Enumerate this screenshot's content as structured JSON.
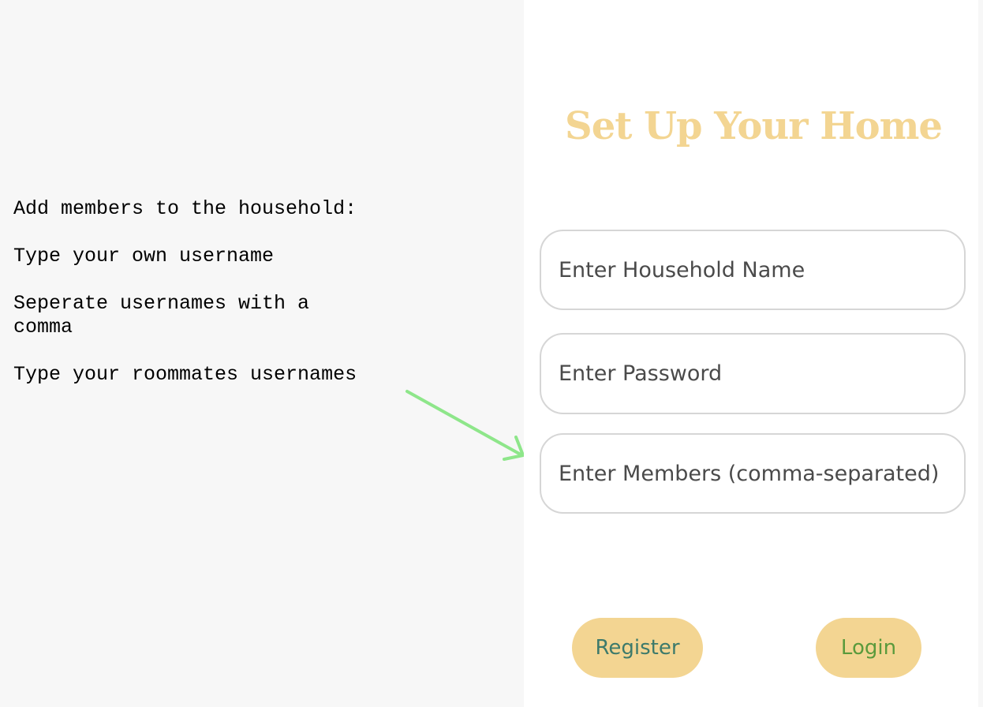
{
  "instructions": {
    "line1": "Add members to the household:",
    "line2": "Type your own username",
    "line3": "Seperate usernames with a comma",
    "line4": "Type your roommates usernames"
  },
  "form": {
    "title": "Set Up Your Home",
    "household_placeholder": "Enter Household Name",
    "password_placeholder": "Enter Password",
    "members_placeholder": "Enter Members (comma-separated)",
    "register_label": "Register",
    "login_label": "Login"
  },
  "colors": {
    "accent": "#f3d592",
    "arrow": "#8ee68a",
    "register_text": "#3d7a6b",
    "login_text": "#5a9a3c"
  },
  "icons": {
    "arrow": "arrow-pointing-to-members-field"
  }
}
